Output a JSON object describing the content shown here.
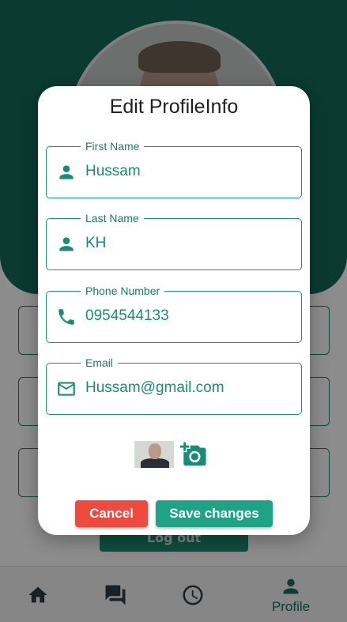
{
  "dialog": {
    "title": "Edit ProfileInfo",
    "fields": [
      {
        "label": "First Name",
        "value": "Hussam",
        "icon": "person-icon"
      },
      {
        "label": "Last Name",
        "value": "KH",
        "icon": "person-icon"
      },
      {
        "label": "Phone Number",
        "value": "0954544133",
        "icon": "phone-icon"
      },
      {
        "label": "Email",
        "value": "Hussam@gmail.com",
        "icon": "email-icon"
      }
    ],
    "photo_icon": "add-photo-icon",
    "cancel_label": "Cancel",
    "save_label": "Save changes"
  },
  "background": {
    "logout_label": "Log out"
  },
  "nav": {
    "items": [
      {
        "icon": "home-icon",
        "label": ""
      },
      {
        "icon": "chat-icon",
        "label": ""
      },
      {
        "icon": "clock-icon",
        "label": ""
      },
      {
        "icon": "person-icon",
        "label": "Profile"
      }
    ]
  },
  "colors": {
    "primary": "#136a5a",
    "accent": "#1fa387",
    "danger": "#f04a3e"
  }
}
